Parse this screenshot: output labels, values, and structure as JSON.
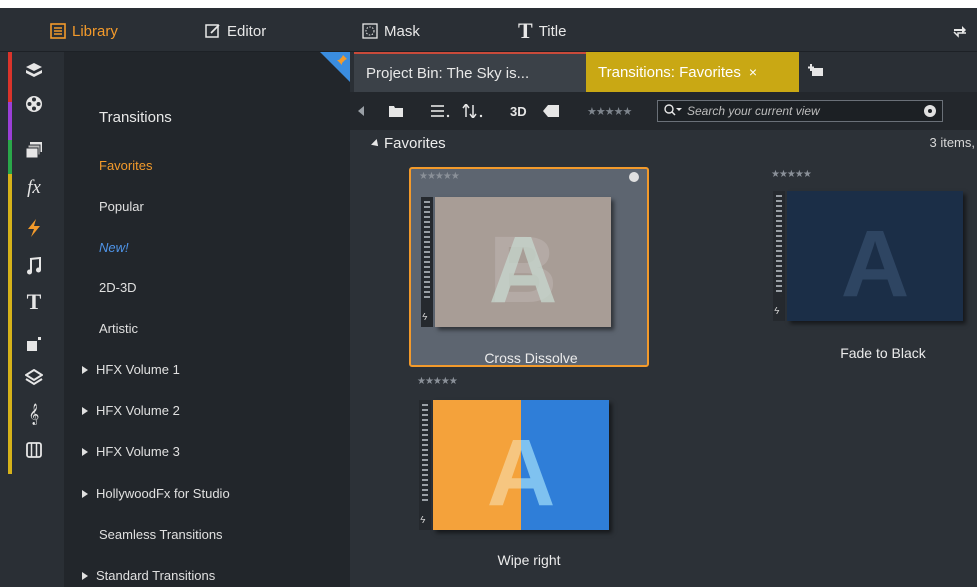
{
  "nav": {
    "library": "Library",
    "editor": "Editor",
    "mask": "Mask",
    "title": "Title"
  },
  "rail": {
    "icons": [
      "media-icon",
      "film-reel-icon",
      "projects-icon",
      "effects-icon",
      "transitions-icon",
      "music-icon",
      "title-icon",
      "montage-icon",
      "layers-icon",
      "score-icon",
      "piano-icon"
    ],
    "colors": [
      "#d9342b",
      "#9b3fd6",
      "#2aa84a",
      "#d6b21a",
      "#e07a1f"
    ]
  },
  "categories": {
    "title": "Transitions",
    "items": [
      {
        "label": "Favorites",
        "state": "selected",
        "expandable": false
      },
      {
        "label": "Popular",
        "state": "normal",
        "expandable": false
      },
      {
        "label": "New!",
        "state": "new",
        "expandable": false
      },
      {
        "label": "2D-3D",
        "state": "normal",
        "expandable": false
      },
      {
        "label": "Artistic",
        "state": "normal",
        "expandable": false
      },
      {
        "label": "HFX Volume 1",
        "state": "normal",
        "expandable": true
      },
      {
        "label": "HFX Volume 2",
        "state": "normal",
        "expandable": true
      },
      {
        "label": "HFX Volume 3",
        "state": "normal",
        "expandable": true
      },
      {
        "label": "HollywoodFx for Studio",
        "state": "normal",
        "expandable": true
      },
      {
        "label": "Seamless Transitions",
        "state": "normal",
        "expandable": false
      },
      {
        "label": "Standard Transitions",
        "state": "normal",
        "expandable": true
      }
    ]
  },
  "tabs": {
    "bin": "Project Bin: The Sky is...",
    "favorites": "Transitions: Favorites",
    "close": "×"
  },
  "toolbar": {
    "three_d": "3D",
    "rating": "★★★★★",
    "search_placeholder": "Search your current view"
  },
  "section": {
    "title": "Favorites",
    "count": "3 items,"
  },
  "items": [
    {
      "name": "Cross Dissolve",
      "rating": "★★★★★",
      "selected": true
    },
    {
      "name": "Fade to Black",
      "rating": "★★★★★",
      "selected": false
    },
    {
      "name": "Wipe right",
      "rating": "★★★★★",
      "selected": false
    }
  ],
  "colors": {
    "accent": "#f39a2b",
    "tab_active": "#c9a814",
    "new_link": "#4f94e8"
  }
}
